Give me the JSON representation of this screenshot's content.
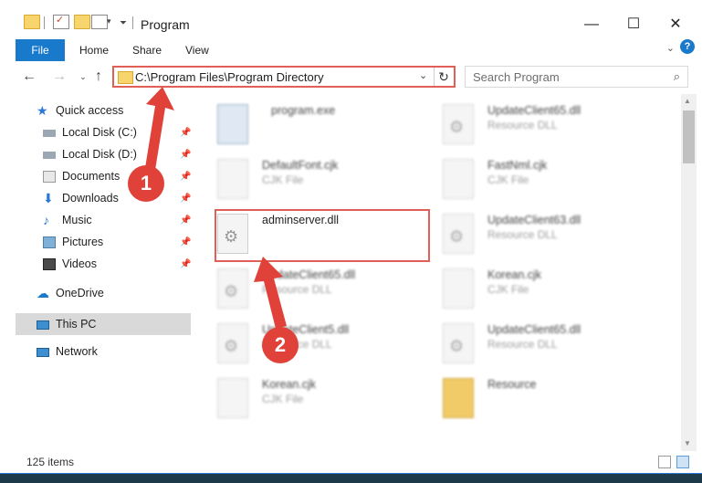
{
  "window": {
    "title": "Program"
  },
  "ribbon": {
    "tabs": [
      "File",
      "Home",
      "Share",
      "View"
    ],
    "help": "?"
  },
  "address": {
    "path": "C:\\Program Files\\Program Directory"
  },
  "search": {
    "placeholder": "Search Program"
  },
  "sidebar": {
    "quick_access": "Quick access",
    "items": [
      "Local Disk (C:)",
      "Local Disk (D:)",
      "Documents",
      "Downloads",
      "Music",
      "Pictures",
      "Videos"
    ],
    "onedrive": "OneDrive",
    "this_pc": "This PC",
    "network": "Network"
  },
  "files": [
    {
      "name": "program.exe",
      "type": "",
      "icon": "exe-icon"
    },
    {
      "name": "UpdateClient65.dll",
      "type": "Resource DLL",
      "icon": "dll-icon"
    },
    {
      "name": "DefaultFont.cjk",
      "type": "CJK File",
      "icon": "file-icon"
    },
    {
      "name": "FastNml.cjk",
      "type": "CJK File",
      "icon": "file-icon"
    },
    {
      "name": "adminserver.dll",
      "type": "",
      "icon": "dll-icon"
    },
    {
      "name": "UpdateClient63.dll",
      "type": "Resource DLL",
      "icon": "dll-icon"
    },
    {
      "name": "UpdateClient65.dll",
      "type": "Resource DLL",
      "icon": "dll-icon"
    },
    {
      "name": "Korean.cjk",
      "type": "CJK File",
      "icon": "file-icon"
    },
    {
      "name": "UpdateClient5.dll",
      "type": "Resource DLL",
      "icon": "dll-icon"
    },
    {
      "name": "UpdateClient65.dll",
      "type": "Resource DLL",
      "icon": "dll-icon"
    },
    {
      "name": "Korean.cjk",
      "type": "CJK File",
      "icon": "file-icon"
    },
    {
      "name": "Resource",
      "type": "",
      "icon": "folder-icon"
    }
  ],
  "status": {
    "count": "125 items"
  },
  "annotations": {
    "step1": "1",
    "step2": "2"
  },
  "colors": {
    "accent": "#1979ca",
    "highlight": "#e06057",
    "badge": "#e0423a"
  }
}
